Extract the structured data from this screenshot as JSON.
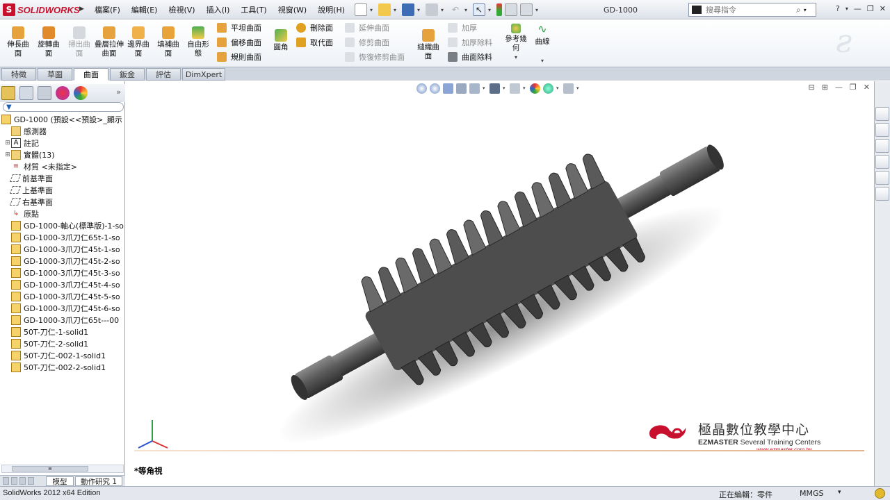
{
  "app": {
    "logo_text": "SOLIDWORKS",
    "document_title": "GD-1000",
    "menus": [
      "檔案(F)",
      "編輯(E)",
      "檢視(V)",
      "插入(I)",
      "工具(T)",
      "視窗(W)",
      "說明(H)"
    ],
    "search_placeholder": "搜尋指令"
  },
  "ribbon": {
    "big_buttons": [
      {
        "label": "伸長曲面",
        "icon": "extruded-surface-icon"
      },
      {
        "label": "旋轉曲面",
        "icon": "revolved-surface-icon"
      },
      {
        "label": "掃出曲面",
        "icon": "swept-surface-icon",
        "disabled": true
      },
      {
        "label": "疊層拉伸曲面",
        "icon": "lofted-surface-icon"
      },
      {
        "label": "邊界曲面",
        "icon": "boundary-surface-icon"
      },
      {
        "label": "填補曲面",
        "icon": "filled-surface-icon"
      },
      {
        "label": "自由形態",
        "icon": "freeform-icon"
      }
    ],
    "col1": [
      "平坦曲面",
      "偏移曲面",
      "規則曲面"
    ],
    "fillet_label": "圓角",
    "col2": [
      "刪除面",
      "取代面"
    ],
    "col3": [
      "延伸曲面",
      "修剪曲面",
      "恢復修剪曲面"
    ],
    "knit_label": "縫織曲面",
    "col4": [
      "加厚",
      "加厚除料",
      "曲面除料"
    ],
    "ref_geometry_label": "參考幾何",
    "curves_label": "曲線"
  },
  "tabs": [
    "特徵",
    "草圖",
    "曲面",
    "鈑金",
    "評估",
    "DimXpert"
  ],
  "active_tab": "曲面",
  "feature_tree": {
    "root": "GD-1000 (預設<<預設>_顯示",
    "items": [
      {
        "label": "感測器",
        "icon": "sensors-folder-icon",
        "expandable": false
      },
      {
        "label": "註記",
        "icon": "annotations-icon",
        "expandable": true
      },
      {
        "label": "實體(13)",
        "icon": "solid-bodies-folder-icon",
        "expandable": true
      },
      {
        "label": "材質 <未指定>",
        "icon": "material-icon",
        "expandable": false
      },
      {
        "label": "前基準面",
        "icon": "plane-icon",
        "expandable": false
      },
      {
        "label": "上基準面",
        "icon": "plane-icon",
        "expandable": false
      },
      {
        "label": "右基準面",
        "icon": "plane-icon",
        "expandable": false
      },
      {
        "label": "原點",
        "icon": "origin-icon",
        "expandable": false
      },
      {
        "label": "GD-1000-軸心(標準版)-1-so",
        "icon": "imported-body-icon",
        "expandable": false
      },
      {
        "label": "GD-1000-3爪刀仁65t-1-so",
        "icon": "imported-body-icon",
        "expandable": false
      },
      {
        "label": "GD-1000-3爪刀仁45t-1-so",
        "icon": "imported-body-icon",
        "expandable": false
      },
      {
        "label": "GD-1000-3爪刀仁45t-2-so",
        "icon": "imported-body-icon",
        "expandable": false
      },
      {
        "label": "GD-1000-3爪刀仁45t-3-so",
        "icon": "imported-body-icon",
        "expandable": false
      },
      {
        "label": "GD-1000-3爪刀仁45t-4-so",
        "icon": "imported-body-icon",
        "expandable": false
      },
      {
        "label": "GD-1000-3爪刀仁45t-5-so",
        "icon": "imported-body-icon",
        "expandable": false
      },
      {
        "label": "GD-1000-3爪刀仁45t-6-so",
        "icon": "imported-body-icon",
        "expandable": false
      },
      {
        "label": "GD-1000-3爪刀仁65t---00",
        "icon": "imported-body-icon",
        "expandable": false
      },
      {
        "label": "50T-刀仁-1-solid1",
        "icon": "imported-body-icon",
        "expandable": false
      },
      {
        "label": "50T-刀仁-2-solid1",
        "icon": "imported-body-icon",
        "expandable": false
      },
      {
        "label": "50T-刀仁-002-1-solid1",
        "icon": "imported-body-icon",
        "expandable": false
      },
      {
        "label": "50T-刀仁-002-2-solid1",
        "icon": "imported-body-icon",
        "expandable": false
      }
    ]
  },
  "bottom_tabs": [
    "模型",
    "動作研究 1"
  ],
  "viewport": {
    "view_name": "*等角視",
    "brand_cn": "極晶數位教學中心",
    "brand_en": "EZMASTER",
    "brand_en2": "Several Training Centers",
    "brand_url": "www.ezmaster.com.tw"
  },
  "status": {
    "app_version": "SolidWorks 2012 x64 Edition",
    "editing": "正在編輯：零件",
    "units": "MMGS"
  },
  "colors": {
    "accent": "#c8102e",
    "model": "#5c5c5c",
    "ribbon_bg": "#eef2f7"
  }
}
